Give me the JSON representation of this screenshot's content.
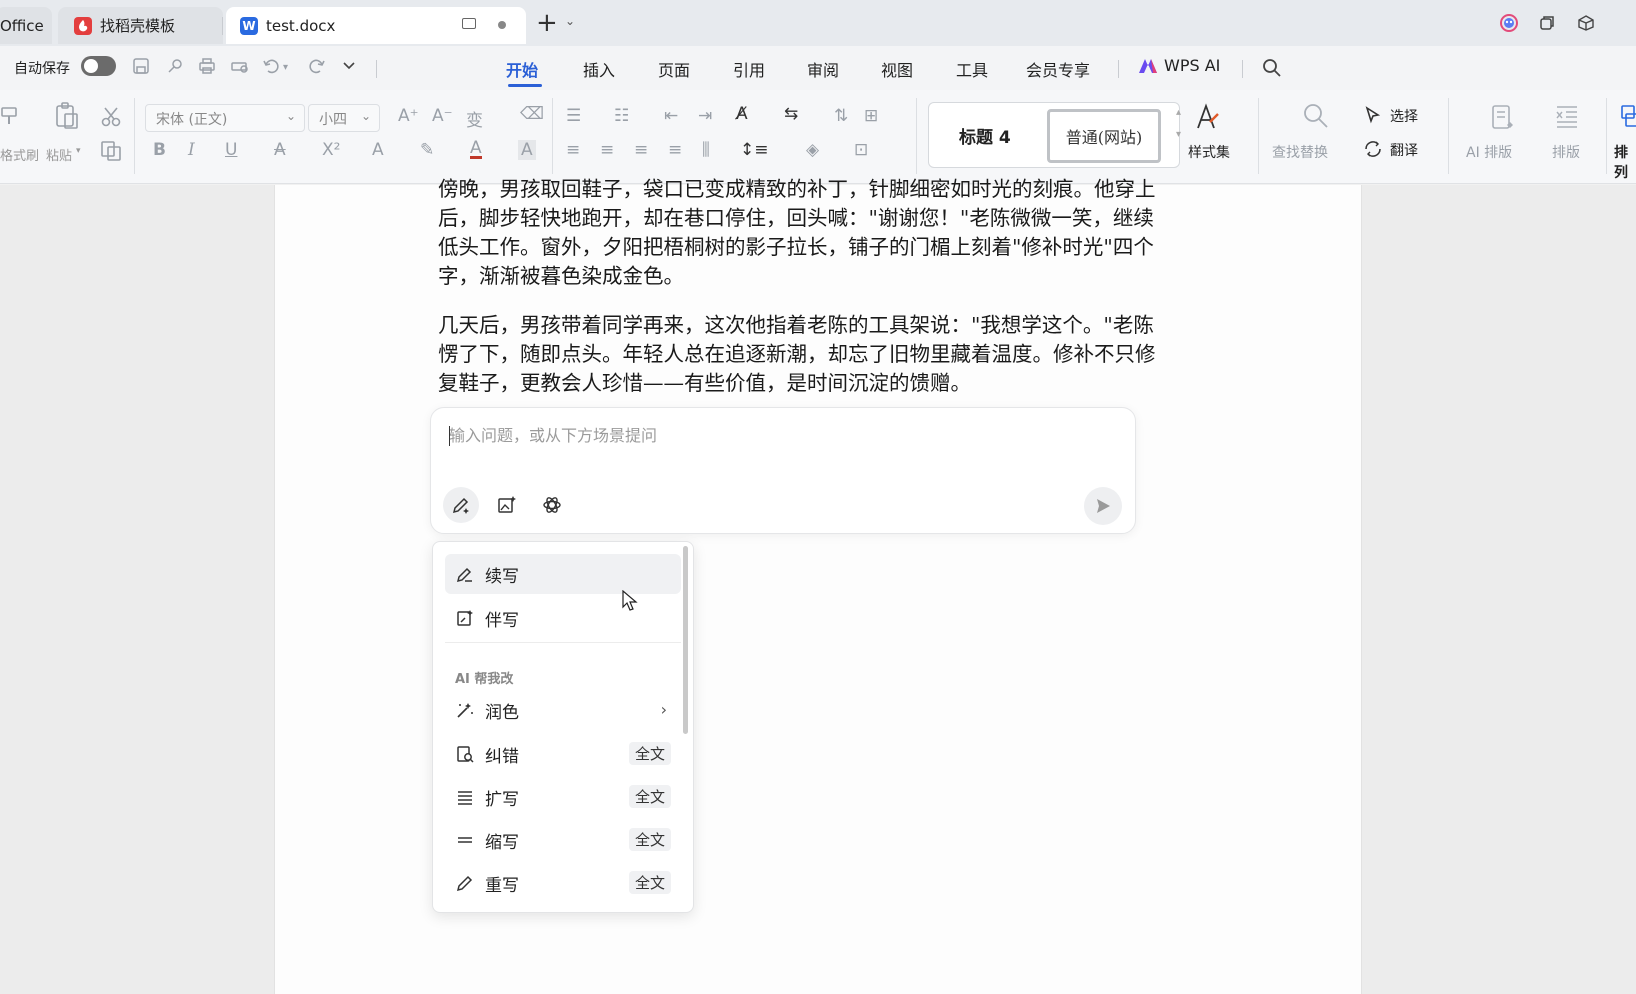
{
  "tabs": [
    {
      "label": "Office",
      "icon": "office-icon"
    },
    {
      "label": "找稻壳模板",
      "icon": "docer-icon"
    },
    {
      "label": "test.docx",
      "icon": "word-doc-icon"
    }
  ],
  "menu": {
    "autosave_label": "自动保存",
    "items": [
      "开始",
      "插入",
      "页面",
      "引用",
      "审阅",
      "视图",
      "工具",
      "会员专享"
    ],
    "active": "开始",
    "wps_ai": "WPS AI"
  },
  "ribbon": {
    "format_painter": "格式刷",
    "paste": "粘贴",
    "font_name": "宋体 (正文)",
    "font_size": "小四",
    "style_heading": "标题 4",
    "style_normal": "普通(网站)",
    "style_set": "样式集",
    "find_replace": "查找替换",
    "select": "选择",
    "translate": "翻译",
    "ai_layout": "AI 排版",
    "layout": "排版",
    "arrange": "排列"
  },
  "document": {
    "paragraph1_lines": [
      "傍晚，男孩取回鞋子，袋口已变成精致的补丁，针脚细密如时光的刻痕。他穿上",
      "后，脚步轻快地跑开，却在巷口停住，回头喊：\"谢谢您！\"老陈微微一笑，继续",
      "低头工作。窗外，夕阳把梧桐树的影子拉长，铺子的门楣上刻着\"修补时光\"四个",
      "字，渐渐被暮色染成金色。"
    ],
    "paragraph2_lines": [
      "几天后，男孩带着同学再来，这次他指着老陈的工具架说：\"我想学这个。\"老陈",
      "愣了下，随即点头。年轻人总在追逐新潮，却忘了旧物里藏着温度。修补不只修",
      "复鞋子，更教会人珍惜——有些价值，是时间沉淀的馈赠。"
    ]
  },
  "ai_panel": {
    "placeholder": "输入问题，或从下方场景提问",
    "value": ""
  },
  "dropdown": {
    "items_top": [
      {
        "label": "续写",
        "icon": "continue-write-icon"
      },
      {
        "label": "伴写",
        "icon": "companion-write-icon"
      }
    ],
    "section_title": "AI 帮我改",
    "items_edit": [
      {
        "label": "润色",
        "icon": "magic-wand-icon",
        "badge": ""
      },
      {
        "label": "纠错",
        "icon": "proofread-icon",
        "badge": "全文"
      },
      {
        "label": "扩写",
        "icon": "expand-lines-icon",
        "badge": "全文"
      },
      {
        "label": "缩写",
        "icon": "shrink-lines-icon",
        "badge": "全文"
      },
      {
        "label": "重写",
        "icon": "pen-icon",
        "badge": "全文"
      }
    ]
  },
  "colors": {
    "accent": "#2a5fd6",
    "word_icon": "#2a6ae0",
    "docer_icon": "#e33e3e"
  }
}
